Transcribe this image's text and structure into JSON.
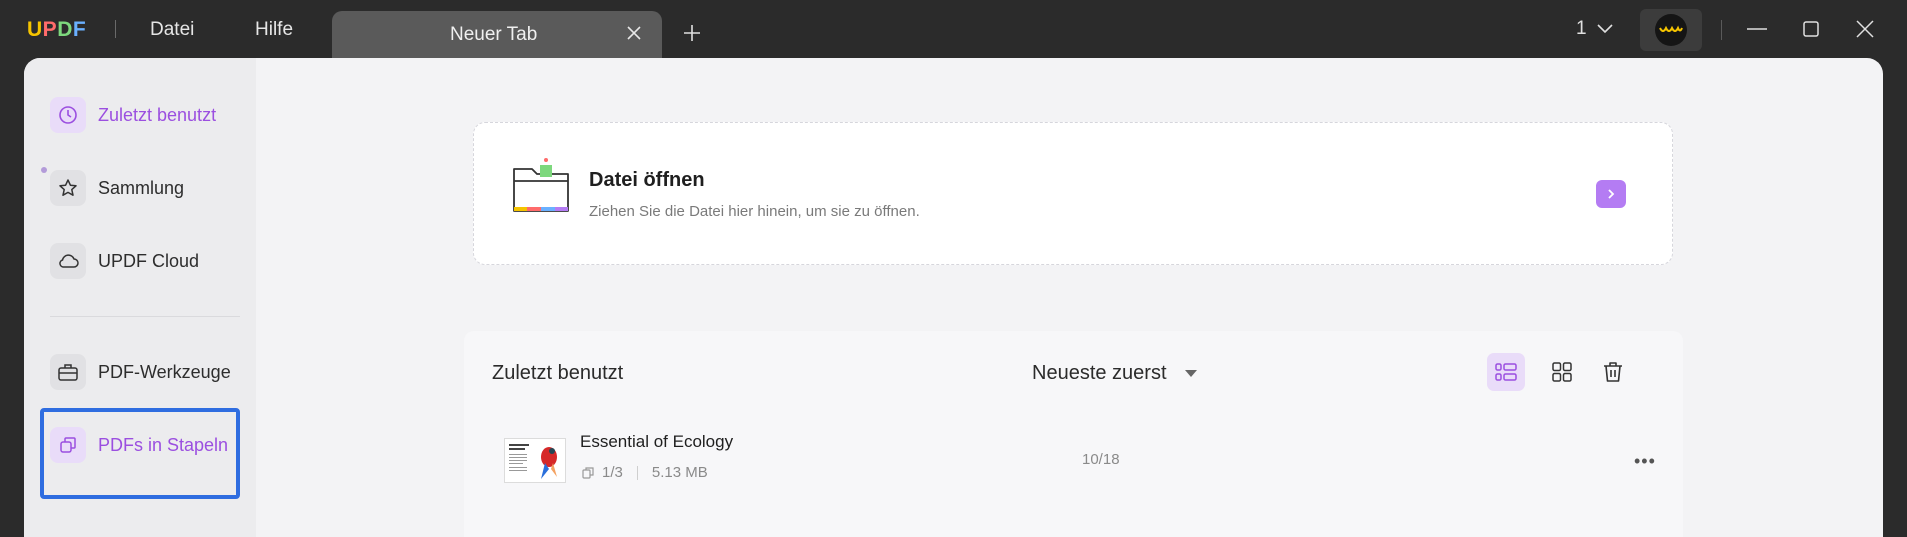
{
  "titlebar": {
    "logo": "UPDF",
    "menu": [
      "Datei",
      "Hilfe"
    ],
    "tab_label": "Neuer Tab",
    "page_count": "1"
  },
  "sidebar": {
    "items": [
      {
        "label": "Zuletzt benutzt",
        "icon": "clock-icon",
        "active": true
      },
      {
        "label": "Sammlung",
        "icon": "star-icon",
        "active": false
      },
      {
        "label": "UPDF Cloud",
        "icon": "cloud-icon",
        "active": false
      },
      {
        "label": "PDF-Werkzeuge",
        "icon": "toolbox-icon",
        "active": false
      },
      {
        "label": "PDFs in Stapeln",
        "icon": "stack-icon",
        "active": false
      }
    ]
  },
  "dropzone": {
    "title": "Datei öffnen",
    "subtitle": "Ziehen Sie die Datei hier hinein, um sie zu öffnen."
  },
  "recent": {
    "title": "Zuletzt benutzt",
    "sort_label": "Neueste zuerst",
    "files": [
      {
        "name": "Essential of Ecology",
        "pages": "1/3",
        "size": "5.13 MB",
        "progress": "10/18"
      }
    ]
  },
  "colors": {
    "accent": "#9b4fe0",
    "accent_light": "#e9dcf9",
    "highlight": "#2f6de0",
    "titlebar": "#2b2b2b"
  }
}
